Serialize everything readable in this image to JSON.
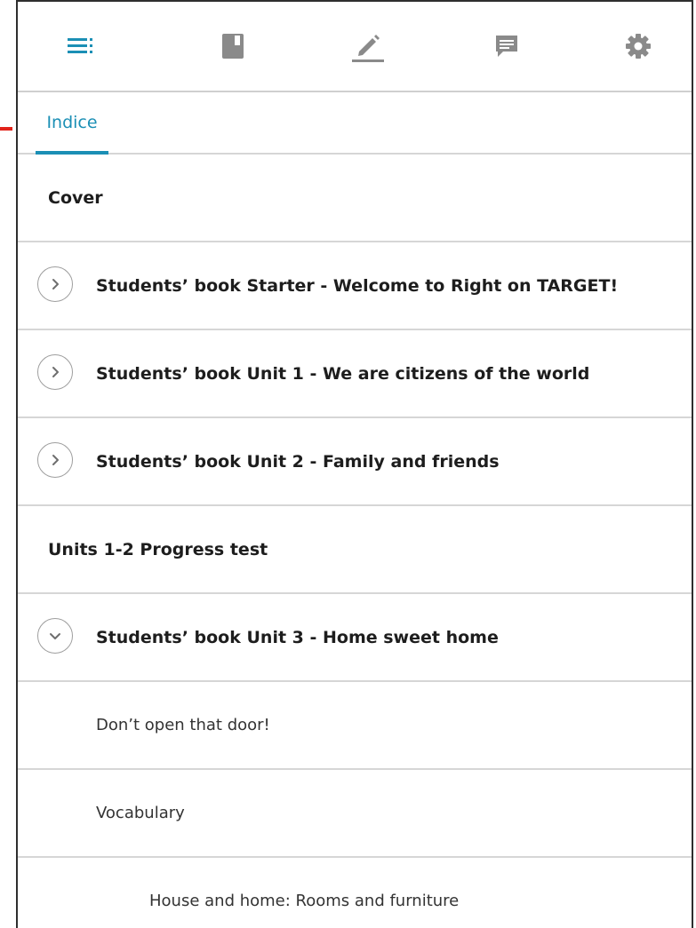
{
  "toolbar": {
    "icons": [
      "list-icon",
      "book-icon",
      "pencil-icon",
      "comment-icon",
      "gear-icon"
    ],
    "active_color": "#1b8fb5",
    "inactive_color": "#8a8a8a"
  },
  "tabs": {
    "active": "Indice"
  },
  "items": [
    {
      "label": "Cover",
      "kind": "plain"
    },
    {
      "label": "Students’ book Starter - Welcome to Right on TARGET!",
      "kind": "expandable",
      "state": "collapsed"
    },
    {
      "label": "Students’ book Unit 1 - We are citizens of the world",
      "kind": "expandable",
      "state": "collapsed"
    },
    {
      "label": "Students’ book Unit 2 - Family and friends",
      "kind": "expandable",
      "state": "collapsed"
    },
    {
      "label": "Units 1-2 Progress test",
      "kind": "plain"
    },
    {
      "label": "Students’ book Unit 3 - Home sweet home",
      "kind": "expandable",
      "state": "expanded"
    },
    {
      "label": "Don’t open that door!",
      "kind": "child"
    },
    {
      "label": "Vocabulary",
      "kind": "child"
    },
    {
      "label": "House and home: Rooms and furniture",
      "kind": "grandchild"
    }
  ]
}
